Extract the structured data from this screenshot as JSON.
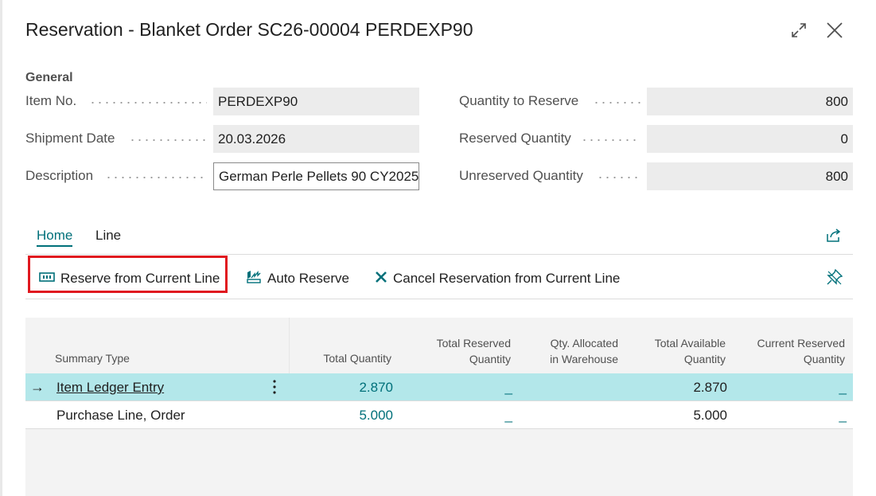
{
  "dialog": {
    "title": "Reservation - Blanket Order SC26-00004 PERDEXP90"
  },
  "window_buttons": {
    "expand_icon": "expand-icon",
    "close_icon": "close-icon"
  },
  "general": {
    "section_title": "General",
    "left_fields": [
      {
        "label": "Item No.",
        "value": "PERDEXP90"
      },
      {
        "label": "Shipment Date",
        "value": "20.03.2026"
      },
      {
        "label": "Description",
        "value": "German Perle Pellets 90 CY2025"
      }
    ],
    "right_fields": [
      {
        "label": "Quantity to Reserve",
        "value": "800"
      },
      {
        "label": "Reserved Quantity",
        "value": "0"
      },
      {
        "label": "Unreserved Quantity",
        "value": "800"
      }
    ]
  },
  "tabs": [
    {
      "label": "Home",
      "active": true
    },
    {
      "label": "Line",
      "active": false
    }
  ],
  "actions": [
    {
      "label": "Reserve from Current Line",
      "icon": "reserve-icon"
    },
    {
      "label": "Auto Reserve",
      "icon": "auto-reserve-icon"
    },
    {
      "label": "Cancel Reservation from Current Line",
      "icon": "cancel-x-icon"
    }
  ],
  "colors": {
    "accent": "#00707a",
    "selected_row": "#b3e7ea",
    "highlight_border": "#e0181f"
  },
  "grid": {
    "columns": [
      {
        "line1": "Summary Type",
        "line2": ""
      },
      {
        "line1": "Total Quantity",
        "line2": ""
      },
      {
        "line1": "Total Reserved",
        "line2": "Quantity"
      },
      {
        "line1": "Qty. Allocated",
        "line2": "in Warehouse"
      },
      {
        "line1": "Total Available",
        "line2": "Quantity"
      },
      {
        "line1": "Current Reserved",
        "line2": "Quantity"
      }
    ],
    "rows": [
      {
        "summary_type": "Item Ledger Entry",
        "total_quantity": "2.870",
        "total_reserved": "_",
        "qty_allocated": "",
        "total_available": "2.870",
        "current_reserved": "_",
        "selected": true
      },
      {
        "summary_type": "Purchase Line, Order",
        "total_quantity": "5.000",
        "total_reserved": "_",
        "qty_allocated": "",
        "total_available": "5.000",
        "current_reserved": "_",
        "selected": false
      }
    ]
  }
}
